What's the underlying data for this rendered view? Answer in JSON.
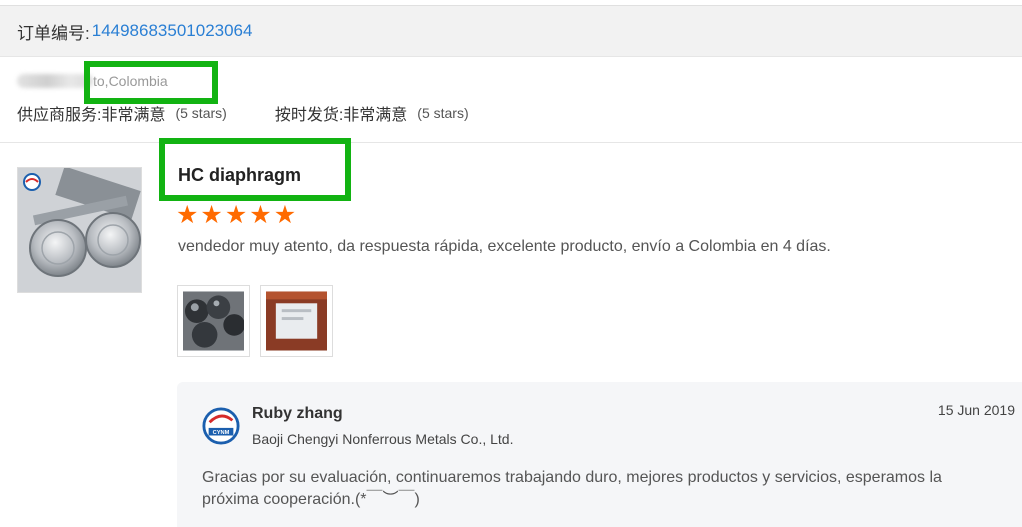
{
  "order": {
    "label": "订单编号:",
    "number": "14498683501023064"
  },
  "buyer": {
    "location": "to,Colombia"
  },
  "ratings": {
    "service_label": "供应商服务:",
    "service_value": "非常满意",
    "service_stars": "(5 stars)",
    "shipping_label": "按时发货:",
    "shipping_value": "非常满意",
    "shipping_stars": "(5 stars)"
  },
  "review": {
    "product_title": "HC diaphragm",
    "stars": [
      "★",
      "★",
      "★",
      "★",
      "★"
    ],
    "text": "vendedor muy atento, da respuesta rápida, excelente producto, envío a Colombia en 4 días."
  },
  "reply": {
    "seller_name": "Ruby zhang",
    "company": "Baoji Chengyi Nonferrous Metals Co., Ltd.",
    "date": "15 Jun 2019",
    "text": "Gracias por su evaluación, continuaremos trabajando duro, mejores productos y servicios, esperamos la próxima cooperación.(*￣︶￣)",
    "logo_text": "CYNM"
  },
  "colors": {
    "accent_link": "#2a7fd4",
    "star": "#ff6a00",
    "highlight": "#12b312"
  }
}
